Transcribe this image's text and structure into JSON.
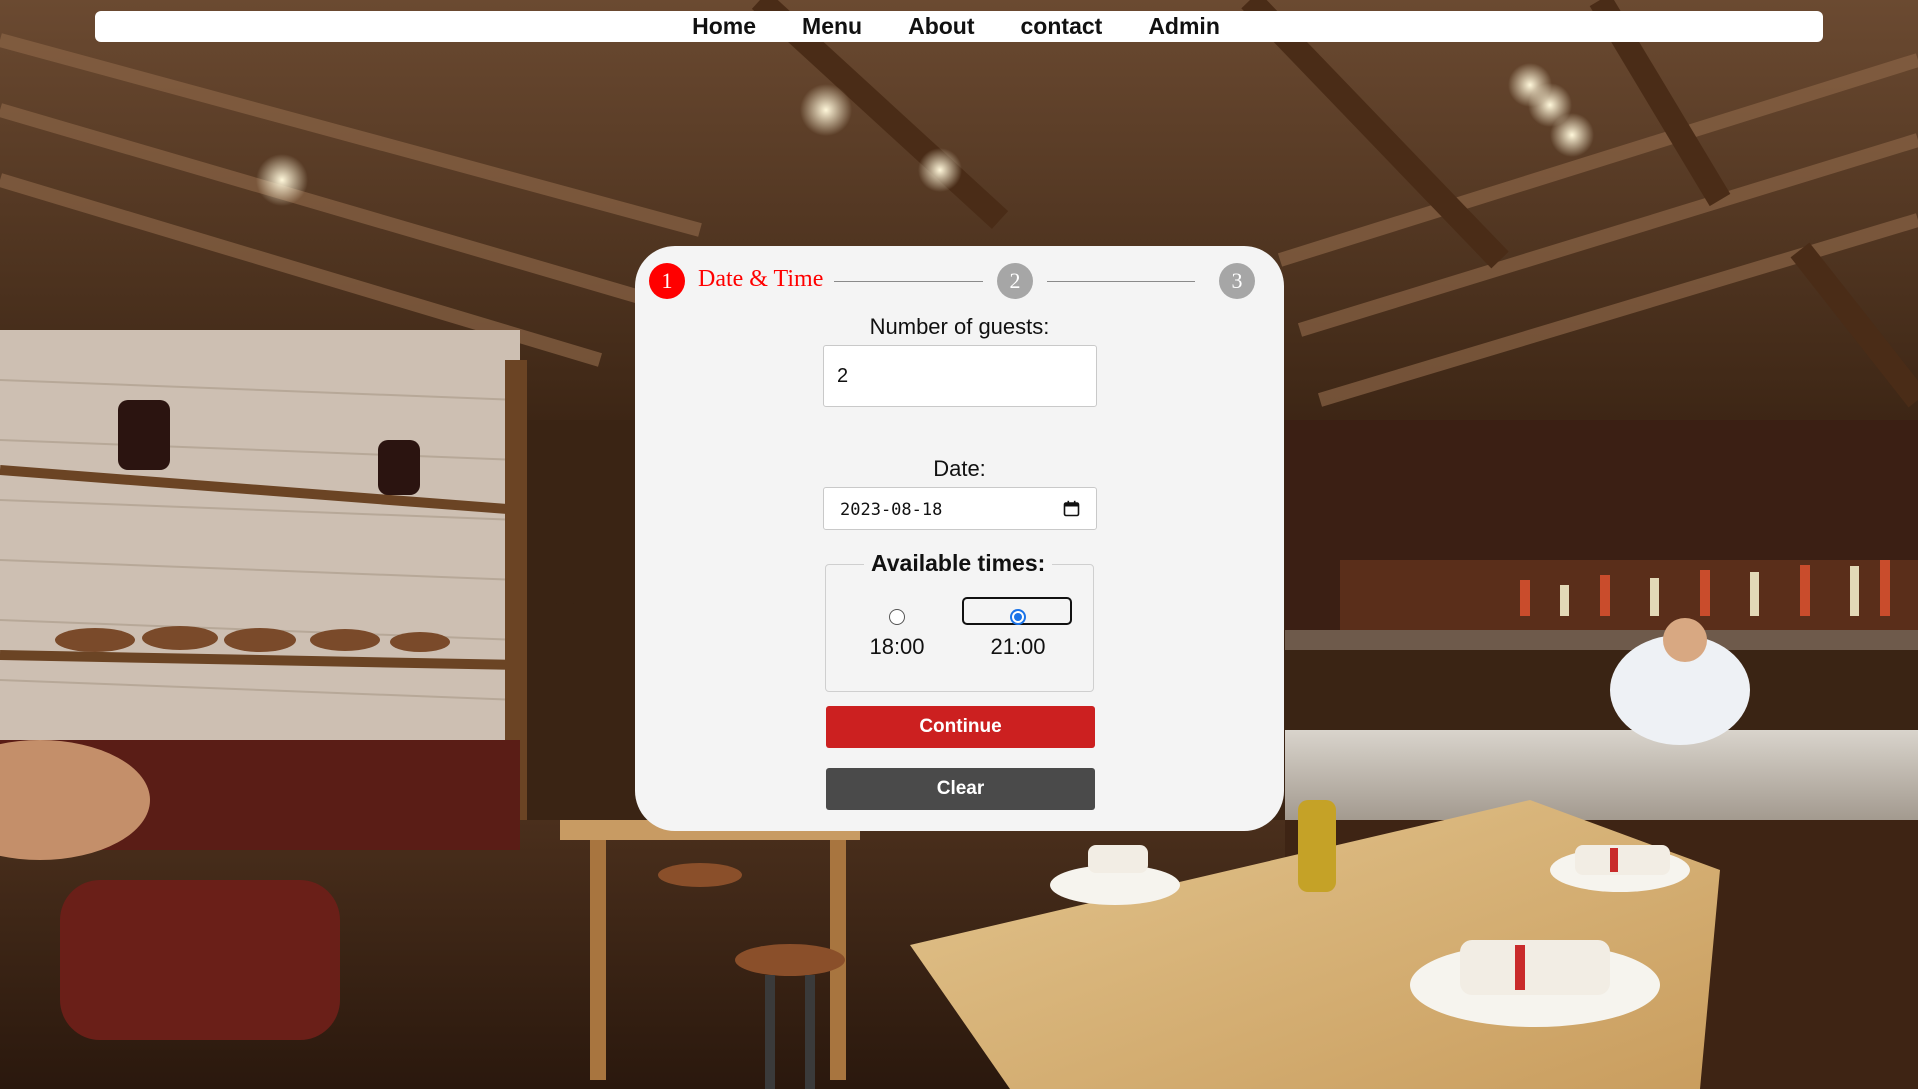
{
  "nav": {
    "items": [
      {
        "label": "Home"
      },
      {
        "label": "Menu"
      },
      {
        "label": "About"
      },
      {
        "label": "contact"
      },
      {
        "label": "Admin"
      }
    ]
  },
  "stepper": {
    "steps": [
      {
        "number": "1",
        "label": "Date & Time",
        "active": true
      },
      {
        "number": "2",
        "active": false
      },
      {
        "number": "3",
        "active": false
      }
    ]
  },
  "form": {
    "guests_label": "Number of guests:",
    "guests_value": "2",
    "date_label": "Date:",
    "date_value": "2023-08-18",
    "times_legend": "Available times:",
    "times": [
      {
        "label": "18:00",
        "selected": false
      },
      {
        "label": "21:00",
        "selected": true
      }
    ],
    "continue_label": "Continue",
    "clear_label": "Clear"
  },
  "colors": {
    "accent": "#ff0000",
    "continue_button": "#cc2020",
    "clear_button": "#4a4a4a",
    "inactive_step": "#a6a6a6",
    "radio_selected": "#1a73e8"
  }
}
